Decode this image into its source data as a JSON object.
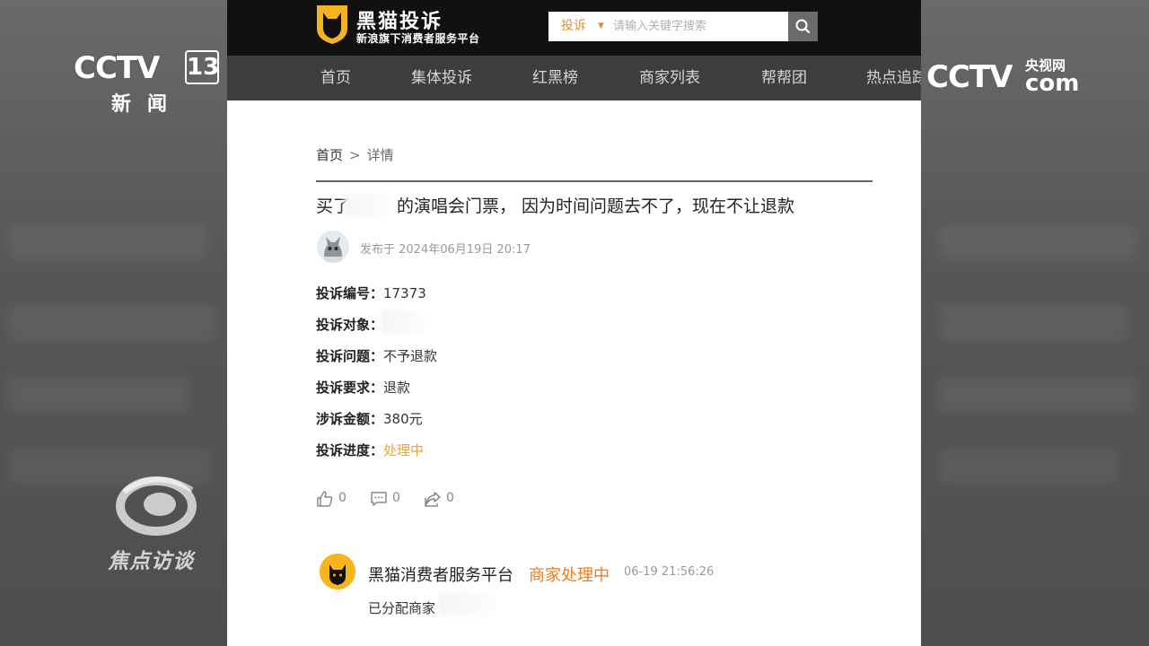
{
  "broadcast": {
    "channel_mark": "CCTV",
    "channel_number": "13",
    "channel_name": "新闻",
    "site_mark": "CCTV",
    "site_cn": "央视网",
    "site_com": "com",
    "program": "焦点访谈"
  },
  "site": {
    "brand": "黑猫投诉",
    "slogan": "新浪旗下消费者服务平台"
  },
  "search": {
    "type_label": "投诉",
    "placeholder": "请输入关键字搜索"
  },
  "nav": {
    "items": [
      {
        "label": "首页"
      },
      {
        "label": "集体投诉"
      },
      {
        "label": "红黑榜"
      },
      {
        "label": "商家列表"
      },
      {
        "label": "帮帮团"
      },
      {
        "label": "热点追踪"
      }
    ]
  },
  "breadcrumb": {
    "home": "首页",
    "separator": ">",
    "current": "详情"
  },
  "complaint": {
    "title_prefix": "买了",
    "title_suffix": "的演唱会门票， 因为时间问题去不了，现在不让退款",
    "posted_at": "发布于 2024年06月19日 20:17",
    "fields": [
      {
        "label": "投诉编号：",
        "value": "17373"
      },
      {
        "label": "投诉对象：",
        "value": ""
      },
      {
        "label": "投诉问题：",
        "value": "不予退款"
      },
      {
        "label": "投诉要求：",
        "value": "退款"
      },
      {
        "label": "涉诉金额：",
        "value": "380元"
      },
      {
        "label": "投诉进度：",
        "value": "处理中",
        "color": "#f0a23a"
      }
    ],
    "likes": "0",
    "comments": "0",
    "shares": "0"
  },
  "reply": {
    "author": "黑猫消费者服务平台",
    "status": "商家处理中",
    "time": "06-19 21:56:26",
    "message": "已分配商家"
  },
  "colors": {
    "accent_orange": "#f0a23a",
    "status_orange": "#f07b1a",
    "topbar": "#111111",
    "navbar": "#3d3d3d"
  }
}
